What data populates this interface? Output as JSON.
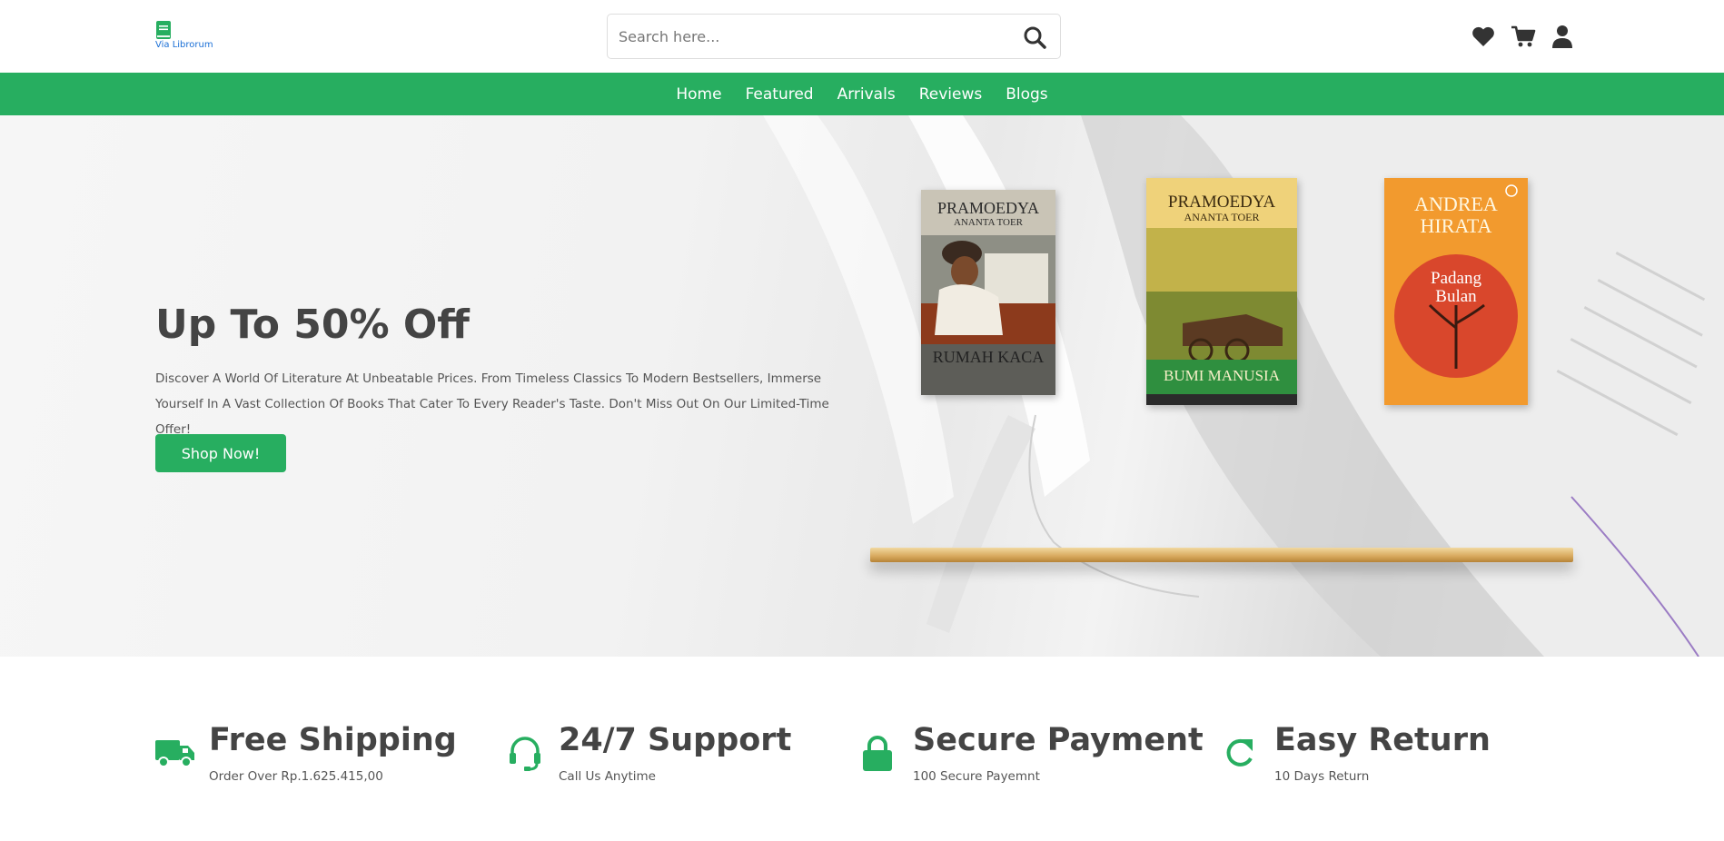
{
  "brand": {
    "name": "Via Librorum"
  },
  "search": {
    "placeholder": "Search here..."
  },
  "header_icons": [
    "heart-icon",
    "cart-icon",
    "user-icon"
  ],
  "nav": {
    "items": [
      "Home",
      "Featured",
      "Arrivals",
      "Reviews",
      "Blogs"
    ]
  },
  "hero": {
    "title": "Up To 50% Off",
    "description": "Discover A World Of Literature At Unbeatable Prices. From Timeless Classics To Modern Bestsellers, Immerse Yourself In A Vast Collection Of Books That Cater To Every Reader's Taste. Don't Miss Out On Our Limited-Time Offer!",
    "cta": "Shop Now!",
    "books": [
      {
        "author_line1": "PRAMOEDYA",
        "author_line2": "ANANTA TOER",
        "title": "RUMAH KACA"
      },
      {
        "author_line1": "PRAMOEDYA",
        "author_line2": "ANANTA TOER",
        "title": "BUMI MANUSIA"
      },
      {
        "author_line1": "ANDREA",
        "author_line2": "HIRATA",
        "title_line1": "Padang",
        "title_line2": "Bulan"
      }
    ]
  },
  "features": [
    {
      "icon": "truck-icon",
      "title": "Free Shipping",
      "subtitle": "Order Over Rp.1.625.415,00"
    },
    {
      "icon": "headset-icon",
      "title": "24/7 Support",
      "subtitle": "Call Us Anytime"
    },
    {
      "icon": "lock-icon",
      "title": "Secure Payment",
      "subtitle": "100 Secure Payemnt"
    },
    {
      "icon": "redo-icon",
      "title": "Easy Return",
      "subtitle": "10 Days Return"
    }
  ],
  "colors": {
    "accent": "#27ae60",
    "text": "#444444",
    "brand_text": "#1a6fd6"
  }
}
